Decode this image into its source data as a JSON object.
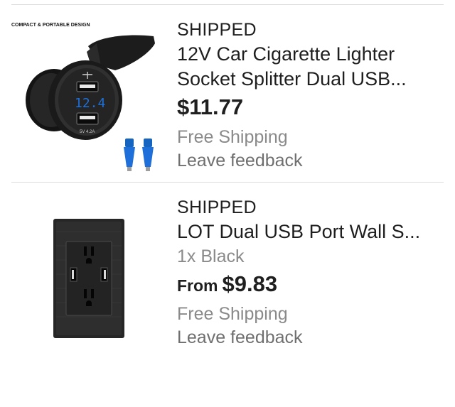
{
  "orders": [
    {
      "status": "SHIPPED",
      "title_line1": "12V Car Cigarette Lighter",
      "title_line2": "Socket Splitter Dual USB...",
      "price": "$11.77",
      "shipping": "Free Shipping",
      "feedback": "Leave feedback",
      "image": {
        "icon": "usb-car-socket-charger-icon",
        "caption": "COMPACT & PORTABLE DESIGN",
        "display_voltage": "12.4",
        "port_label": "5V 4.2A",
        "accent_color": "#1e6fd9"
      }
    },
    {
      "status": "SHIPPED",
      "title_line1": "LOT Dual USB Port Wall S...",
      "variant": "1x Black",
      "price_prefix": "From",
      "price": "$9.83",
      "shipping": "Free Shipping",
      "feedback": "Leave feedback",
      "image": {
        "icon": "usb-wall-outlet-icon",
        "color": "#2a2a2a"
      }
    }
  ]
}
